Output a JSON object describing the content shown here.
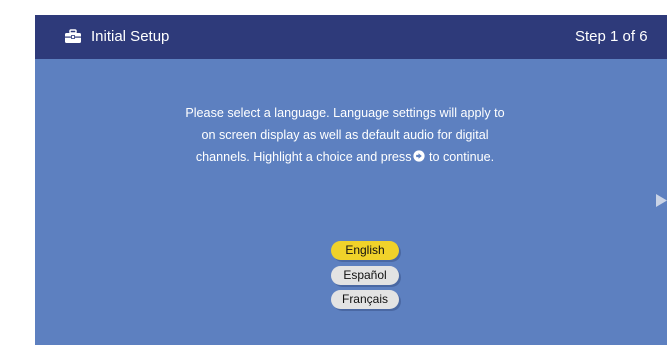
{
  "header": {
    "title": "Initial Setup",
    "step": "Step 1 of 6",
    "icon": "toolbox-icon"
  },
  "instructions": {
    "line1": "Please select a language.  Language settings will apply to",
    "line2": "on screen display as well as default audio for digital",
    "line3_before": "channels. Highlight a choice and press",
    "line3_after": " to continue.",
    "button_icon": "ok-button-icon"
  },
  "languages": [
    {
      "label": "English",
      "selected": true
    },
    {
      "label": "Español",
      "selected": false
    },
    {
      "label": "Français",
      "selected": false
    }
  ],
  "navigation": {
    "next_icon": "next-arrow-icon"
  },
  "colors": {
    "background": "#5d80c0",
    "header": "#2e3a7a",
    "selected": "#f0d22a",
    "option": "#e3e3e3"
  }
}
